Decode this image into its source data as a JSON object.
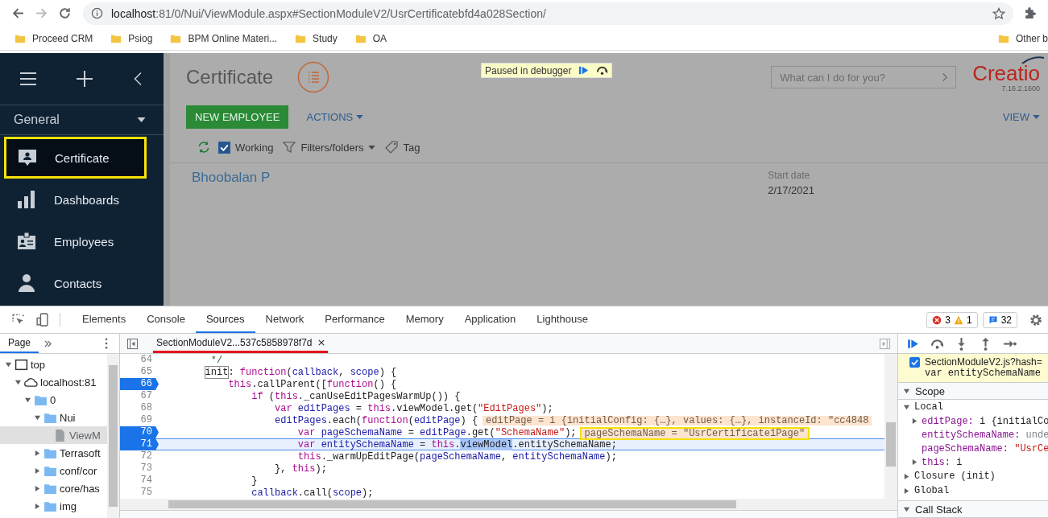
{
  "browser": {
    "back": {
      "disabled": false
    },
    "forward": {
      "disabled": true
    },
    "address_host": "localhost",
    "address_path": ":81/0/Nui/ViewModule.aspx#SectionModuleV2/UsrCertificatebfd4a028Section/"
  },
  "bookmarks": [
    {
      "label": "Proceed CRM"
    },
    {
      "label": "Psiog"
    },
    {
      "label": "BPM Online Materi..."
    },
    {
      "label": "Study"
    },
    {
      "label": "OA"
    }
  ],
  "other_bookmarks": "Other b",
  "app": {
    "sidebar": {
      "section": "General",
      "items": [
        {
          "label": "Certificate",
          "kind": "card",
          "selected": true,
          "annotated": true
        },
        {
          "label": "Dashboards",
          "kind": "chart",
          "selected": false,
          "annotated": false
        },
        {
          "label": "Employees",
          "kind": "badge",
          "selected": false,
          "annotated": false
        },
        {
          "label": "Contacts",
          "kind": "person",
          "selected": false,
          "annotated": false
        }
      ]
    },
    "title": "Certificate",
    "debugger_banner": "Paused in debugger",
    "search": {
      "placeholder": "What can I do for you?"
    },
    "logo": "Creatio",
    "version": "7.16.2.1600",
    "new_button": "NEW EMPLOYEE",
    "actions": "ACTIONS",
    "view": "VIEW",
    "filters": {
      "working_checked": true,
      "working": "Working",
      "folders": "Filters/folders",
      "tag": "Tag"
    },
    "record": {
      "name": "Bhoobalan P",
      "date_label": "Start date",
      "date": "2/17/2021"
    }
  },
  "devtools": {
    "tabs": [
      {
        "label": "Elements",
        "selected": false
      },
      {
        "label": "Console",
        "selected": false
      },
      {
        "label": "Sources",
        "selected": true
      },
      {
        "label": "Network",
        "selected": false
      },
      {
        "label": "Performance",
        "selected": false
      },
      {
        "label": "Memory",
        "selected": false
      },
      {
        "label": "Application",
        "selected": false
      },
      {
        "label": "Lighthouse",
        "selected": false
      }
    ],
    "errors": "3",
    "warnings": "1",
    "messages": "32",
    "navigator": {
      "tab": "Page",
      "tree": [
        {
          "label": "top",
          "kind": "frame",
          "expanded": true,
          "selected": false,
          "children": [
            {
              "label": "localhost:81",
              "kind": "cloud",
              "expanded": true,
              "selected": false,
              "children": [
                {
                  "label": "0",
                  "kind": "folder",
                  "expanded": true,
                  "selected": false,
                  "children": [
                    {
                      "label": "Nui",
                      "kind": "folder",
                      "expanded": true,
                      "selected": false,
                      "children": [
                        {
                          "label": "ViewM",
                          "kind": "file",
                          "selected": true
                        }
                      ]
                    },
                    {
                      "label": "Terrasoft",
                      "kind": "folder",
                      "expanded": false,
                      "selected": false
                    },
                    {
                      "label": "conf/cor",
                      "kind": "folder",
                      "expanded": false,
                      "selected": false
                    },
                    {
                      "label": "core/has",
                      "kind": "folder",
                      "expanded": false,
                      "selected": false
                    },
                    {
                      "label": "img",
                      "kind": "folder",
                      "expanded": false,
                      "selected": false
                    }
                  ]
                }
              ]
            }
          ]
        }
      ]
    }
  },
  "editor": {
    "file_tab": "SectionModuleV2...537c5858978f7d",
    "underlined": true,
    "lines": [
      {
        "number": "64",
        "breakpoint": false,
        "current": false,
        "tokens": [
          {
            "kind": "comment",
            "text": "         */"
          }
        ]
      },
      {
        "number": "65",
        "breakpoint": false,
        "current": false,
        "tokens": [
          {
            "kind": "match",
            "text": "        init"
          },
          {
            "kind": "plain",
            "text": ": "
          },
          {
            "kind": "kw",
            "text": "function"
          },
          {
            "kind": "plain",
            "text": "("
          },
          {
            "kind": "def",
            "text": "callback"
          },
          {
            "kind": "plain",
            "text": ", "
          },
          {
            "kind": "def",
            "text": "scope"
          },
          {
            "kind": "plain",
            "text": ") {"
          }
        ]
      },
      {
        "number": "66",
        "breakpoint": true,
        "current": false,
        "tokens": [
          {
            "kind": "kw",
            "text": "            this"
          },
          {
            "kind": "plain",
            "text": ".callParent(["
          },
          {
            "kind": "kw",
            "text": "function"
          },
          {
            "kind": "plain",
            "text": "() {"
          }
        ]
      },
      {
        "number": "67",
        "breakpoint": false,
        "current": false,
        "tokens": [
          {
            "kind": "kw",
            "text": "                if"
          },
          {
            "kind": "plain",
            "text": " ("
          },
          {
            "kind": "kw",
            "text": "this"
          },
          {
            "kind": "plain",
            "text": "._canUseEditPagesWarmUp()) {"
          }
        ]
      },
      {
        "number": "68",
        "breakpoint": false,
        "current": false,
        "tokens": [
          {
            "kind": "kw",
            "text": "                    var"
          },
          {
            "kind": "def",
            "text": " editPages"
          },
          {
            "kind": "plain",
            "text": " = "
          },
          {
            "kind": "kw",
            "text": "this"
          },
          {
            "kind": "plain",
            "text": ".viewModel.get("
          },
          {
            "kind": "str",
            "text": "\"EditPages\""
          },
          {
            "kind": "plain",
            "text": ");"
          }
        ]
      },
      {
        "number": "69",
        "breakpoint": false,
        "current": false,
        "tokens": [
          {
            "kind": "def",
            "text": "                    editPages"
          },
          {
            "kind": "plain",
            "text": ".each("
          },
          {
            "kind": "kw",
            "text": "function"
          },
          {
            "kind": "plain",
            "text": "("
          },
          {
            "kind": "def",
            "text": "editPage"
          },
          {
            "kind": "plain",
            "text": ") {"
          }
        ],
        "inline": {
          "text": "editPage = i {initialConfig: {…}, values: {…}, instanceId: \"cc4848",
          "annotated": false
        }
      },
      {
        "number": "70",
        "breakpoint": true,
        "current": false,
        "tokens": [
          {
            "kind": "kw",
            "text": "                        var"
          },
          {
            "kind": "def",
            "text": " pageSchemaName"
          },
          {
            "kind": "plain",
            "text": " = "
          },
          {
            "kind": "def",
            "text": "editPage"
          },
          {
            "kind": "plain",
            "text": ".get("
          },
          {
            "kind": "str",
            "text": "\"SchemaName\""
          },
          {
            "kind": "plain",
            "text": ");"
          }
        ],
        "inline": {
          "text": "pageSchemaName = \"UsrCertificate1Page\"",
          "annotated": true
        }
      },
      {
        "number": "71",
        "breakpoint": true,
        "current": true,
        "tokens": [
          {
            "kind": "kw",
            "text": "                        var"
          },
          {
            "kind": "def",
            "text": " entitySchemaName"
          },
          {
            "kind": "plain",
            "text": " = "
          },
          {
            "kind": "kw",
            "text": "this"
          },
          {
            "kind": "plain",
            "text": "."
          },
          {
            "kind": "selection",
            "text": "viewModel"
          },
          {
            "kind": "plain",
            "text": ".entitySchemaName;"
          }
        ]
      },
      {
        "number": "72",
        "breakpoint": false,
        "current": false,
        "tokens": [
          {
            "kind": "kw",
            "text": "                        this"
          },
          {
            "kind": "plain",
            "text": "._warmUpEditPage("
          },
          {
            "kind": "def",
            "text": "pageSchemaName"
          },
          {
            "kind": "plain",
            "text": ", "
          },
          {
            "kind": "def",
            "text": "entitySchemaName"
          },
          {
            "kind": "plain",
            "text": ");"
          }
        ]
      },
      {
        "number": "73",
        "breakpoint": false,
        "current": false,
        "tokens": [
          {
            "kind": "plain",
            "text": "                    }, "
          },
          {
            "kind": "kw",
            "text": "this"
          },
          {
            "kind": "plain",
            "text": ");"
          }
        ]
      },
      {
        "number": "74",
        "breakpoint": false,
        "current": false,
        "tokens": [
          {
            "kind": "plain",
            "text": "                }"
          }
        ]
      },
      {
        "number": "75",
        "breakpoint": false,
        "current": false,
        "tokens": [
          {
            "kind": "def",
            "text": "                callback"
          },
          {
            "kind": "plain",
            "text": ".call("
          },
          {
            "kind": "def",
            "text": "scope"
          },
          {
            "kind": "plain",
            "text": ");"
          }
        ]
      }
    ]
  },
  "debugger": {
    "breakpoint": {
      "checked": true,
      "file": "SectionModuleV2.js?hash=",
      "code": "var entitySchemaName"
    },
    "scope": {
      "label": "Scope",
      "expanded": true,
      "groups": [
        {
          "label": "Local",
          "expanded": true,
          "vars": [
            {
              "name": "editPage:",
              "value": "i {initialCo",
              "kind": "object",
              "expandable": true
            },
            {
              "name": "entitySchemaName:",
              "value": "unde",
              "kind": "undefined",
              "expandable": false
            },
            {
              "name": "pageSchemaName:",
              "value": "\"UsrCe",
              "kind": "string",
              "expandable": false
            },
            {
              "name": "this:",
              "value": "i",
              "kind": "object",
              "expandable": true
            }
          ]
        },
        {
          "label": "Closure (init)",
          "expanded": false
        },
        {
          "label": "Global",
          "expanded": false
        }
      ]
    },
    "call_stack": {
      "label": "Call Stack",
      "expanded": true
    }
  }
}
